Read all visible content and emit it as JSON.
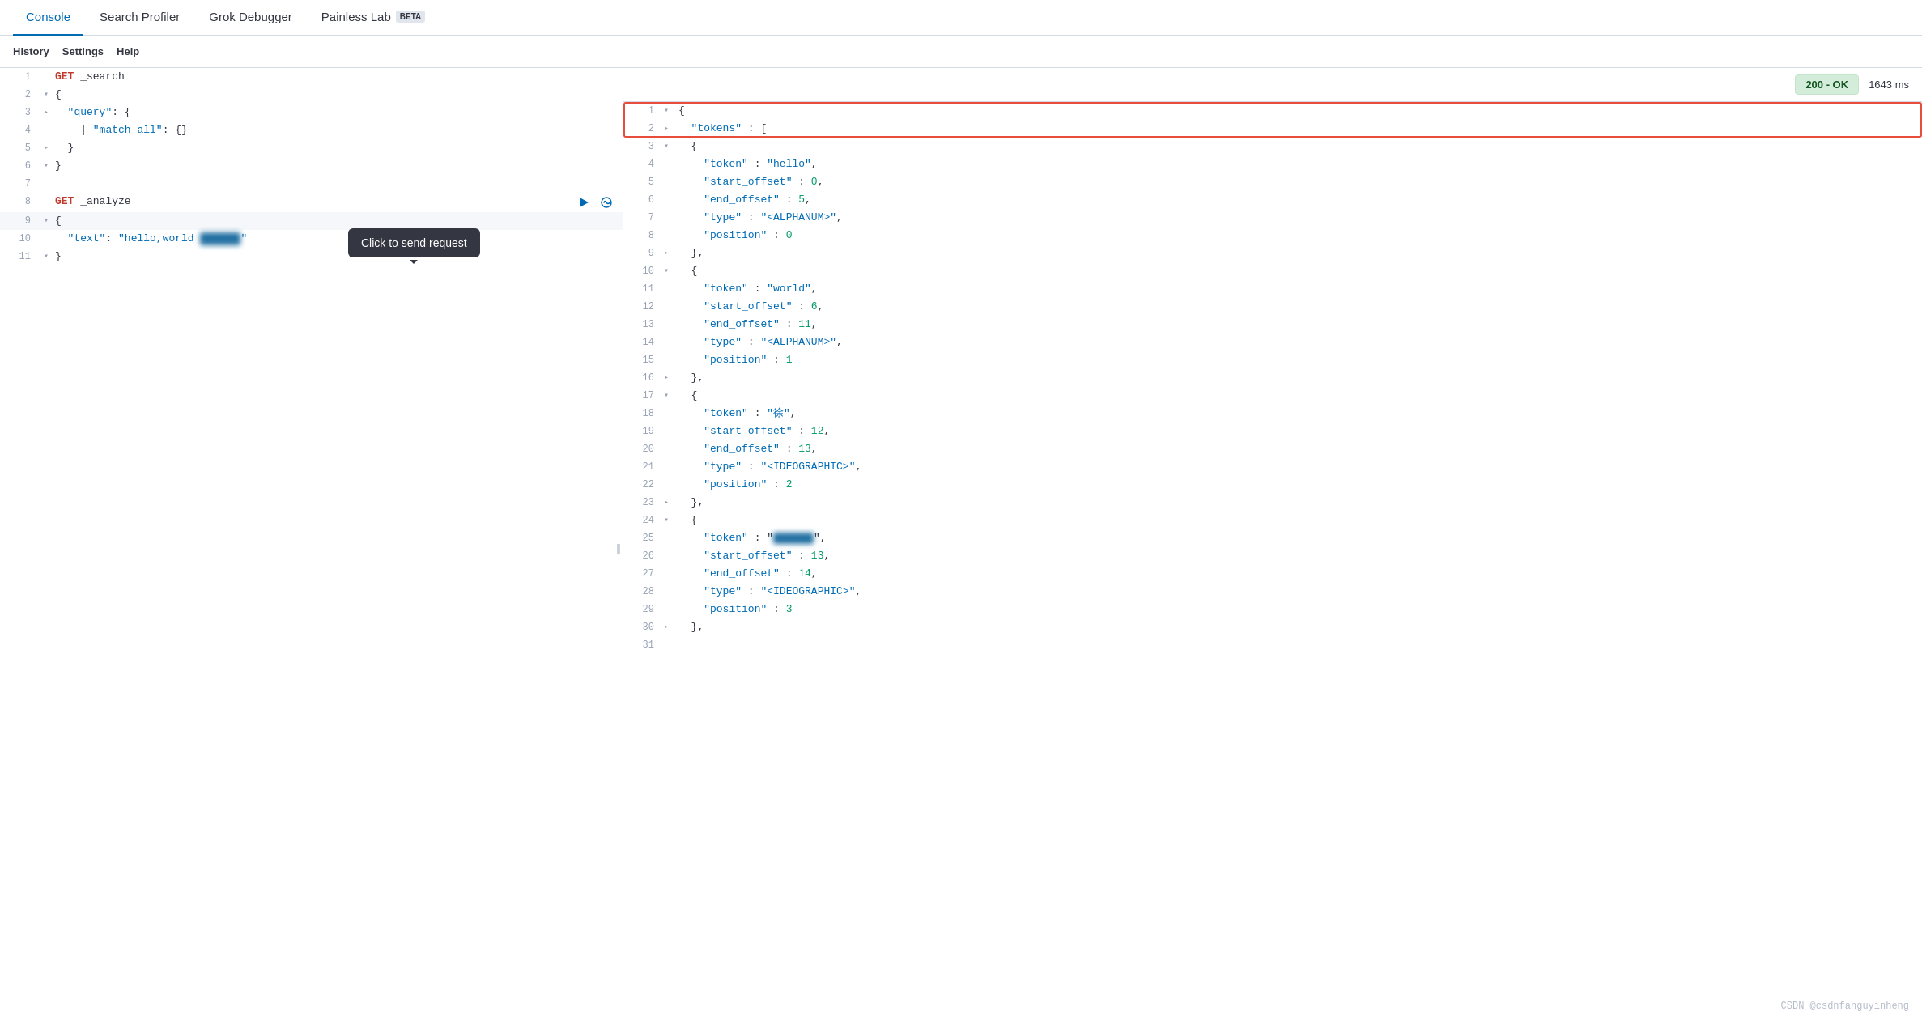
{
  "topNav": {
    "tabs": [
      {
        "id": "console",
        "label": "Console",
        "active": true,
        "beta": false
      },
      {
        "id": "search-profiler",
        "label": "Search Profiler",
        "active": false,
        "beta": false
      },
      {
        "id": "grok-debugger",
        "label": "Grok Debugger",
        "active": false,
        "beta": false
      },
      {
        "id": "painless-lab",
        "label": "Painless Lab",
        "active": false,
        "beta": true
      }
    ]
  },
  "secondaryNav": {
    "buttons": [
      "History",
      "Settings",
      "Help"
    ]
  },
  "editor": {
    "lines": [
      {
        "num": 1,
        "fold": null,
        "content": "GET _search",
        "type": "get"
      },
      {
        "num": 2,
        "fold": "▾",
        "content": "{",
        "type": "bracket"
      },
      {
        "num": 3,
        "fold": "▸",
        "content": "  \"query\": {",
        "type": "key"
      },
      {
        "num": 4,
        "fold": null,
        "content": "    | \"match_all\": {}",
        "type": "key"
      },
      {
        "num": 5,
        "fold": "▸",
        "content": "  }",
        "type": "bracket"
      },
      {
        "num": 6,
        "fold": "▾",
        "content": "}",
        "type": "bracket"
      },
      {
        "num": 7,
        "fold": null,
        "content": "",
        "type": "blank"
      },
      {
        "num": 8,
        "fold": null,
        "content": "GET _analyze",
        "type": "get",
        "actions": true
      },
      {
        "num": 9,
        "fold": "▾",
        "content": "{",
        "type": "bracket",
        "highlighted": true
      },
      {
        "num": 10,
        "fold": null,
        "content": "  \"text\": \"hello,world [REDACTED]\"",
        "type": "key"
      },
      {
        "num": 11,
        "fold": "▾",
        "content": "}",
        "type": "bracket"
      }
    ]
  },
  "tooltip": {
    "text": "Click to send request"
  },
  "output": {
    "statusBadge": "200 - OK",
    "timing": "1643 ms",
    "lines": [
      {
        "num": 1,
        "fold": "▾",
        "content": "{",
        "highlighted": true
      },
      {
        "num": 2,
        "fold": "▸",
        "content": "  \"tokens\" : [",
        "highlighted": true
      },
      {
        "num": 3,
        "fold": "▾",
        "content": "  {"
      },
      {
        "num": 4,
        "fold": null,
        "content": "    \"token\" : \"hello\","
      },
      {
        "num": 5,
        "fold": null,
        "content": "    \"start_offset\" : 0,"
      },
      {
        "num": 6,
        "fold": null,
        "content": "    \"end_offset\" : 5,"
      },
      {
        "num": 7,
        "fold": null,
        "content": "    \"type\" : \"<ALPHANUM>\","
      },
      {
        "num": 8,
        "fold": null,
        "content": "    \"position\" : 0"
      },
      {
        "num": 9,
        "fold": "▸",
        "content": "  },"
      },
      {
        "num": 10,
        "fold": "▾",
        "content": "  {"
      },
      {
        "num": 11,
        "fold": null,
        "content": "    \"token\" : \"world\","
      },
      {
        "num": 12,
        "fold": null,
        "content": "    \"start_offset\" : 6,"
      },
      {
        "num": 13,
        "fold": null,
        "content": "    \"end_offset\" : 11,"
      },
      {
        "num": 14,
        "fold": null,
        "content": "    \"type\" : \"<ALPHANUM>\","
      },
      {
        "num": 15,
        "fold": null,
        "content": "    \"position\" : 1"
      },
      {
        "num": 16,
        "fold": "▸",
        "content": "  },"
      },
      {
        "num": 17,
        "fold": "▾",
        "content": "  {"
      },
      {
        "num": 18,
        "fold": null,
        "content": "    \"token\" : \"徐\","
      },
      {
        "num": 19,
        "fold": null,
        "content": "    \"start_offset\" : 12,"
      },
      {
        "num": 20,
        "fold": null,
        "content": "    \"end_offset\" : 13,"
      },
      {
        "num": 21,
        "fold": null,
        "content": "    \"type\" : \"<IDEOGRAPHIC>\","
      },
      {
        "num": 22,
        "fold": null,
        "content": "    \"position\" : 2"
      },
      {
        "num": 23,
        "fold": "▸",
        "content": "  },"
      },
      {
        "num": 24,
        "fold": "▾",
        "content": "  {"
      },
      {
        "num": 25,
        "fold": null,
        "content": "    \"token\" : \"[REDACTED]\",",
        "redacted": true
      },
      {
        "num": 26,
        "fold": null,
        "content": "    \"start_offset\" : 13,"
      },
      {
        "num": 27,
        "fold": null,
        "content": "    \"end_offset\" : 14,"
      },
      {
        "num": 28,
        "fold": null,
        "content": "    \"type\" : \"<IDEOGRAPHIC>\","
      },
      {
        "num": 29,
        "fold": null,
        "content": "    \"position\" : 3"
      },
      {
        "num": 30,
        "fold": "▸",
        "content": "  },"
      },
      {
        "num": 31,
        "fold": null,
        "content": ""
      }
    ]
  },
  "watermark": "CSDN @csdnfanguyinheng"
}
